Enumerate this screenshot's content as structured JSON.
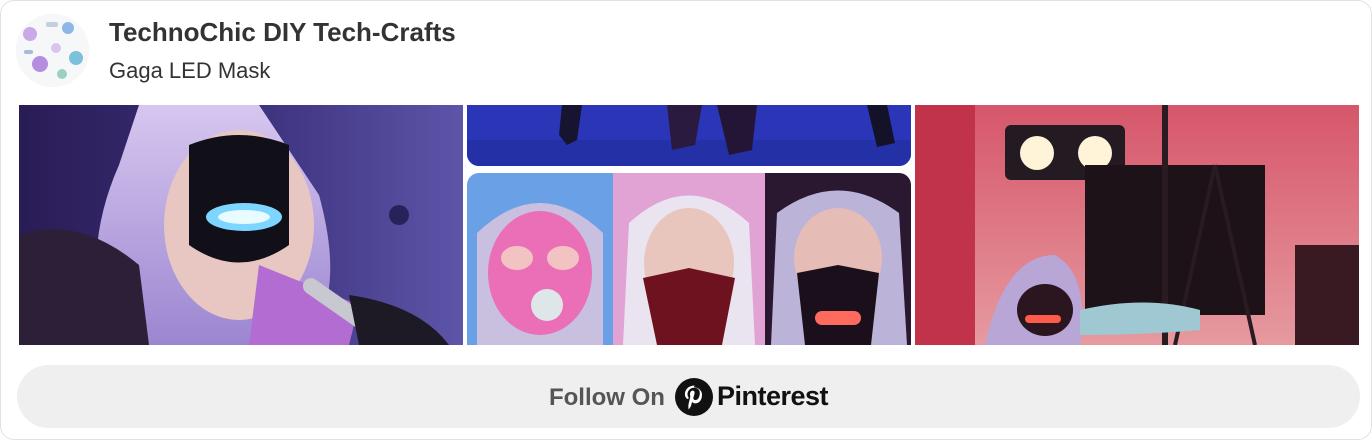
{
  "board": {
    "title": "TechnoChic DIY Tech-Crafts",
    "subtitle": "Gaga LED Mask",
    "avatar_icon": "board-avatar-image"
  },
  "pins": [
    {
      "id": "pin-1",
      "description": "Performer with purple hair wearing black LED mask, holding microphone"
    },
    {
      "id": "pin-2",
      "description": "Stage performers on blue stage"
    },
    {
      "id": "pin-3",
      "description": "Three masked portraits: pink mask, red mask, LED mask"
    },
    {
      "id": "pin-4",
      "description": "Performer in LED mask on red-lit stage with spotlights"
    }
  ],
  "follow": {
    "label": "Follow On",
    "brand": "Pinterest",
    "icon": "pinterest-logo-icon"
  },
  "colors": {
    "title_text": "#333333",
    "button_bg": "#efefef",
    "button_text": "#555555",
    "brand_text": "#111111"
  }
}
